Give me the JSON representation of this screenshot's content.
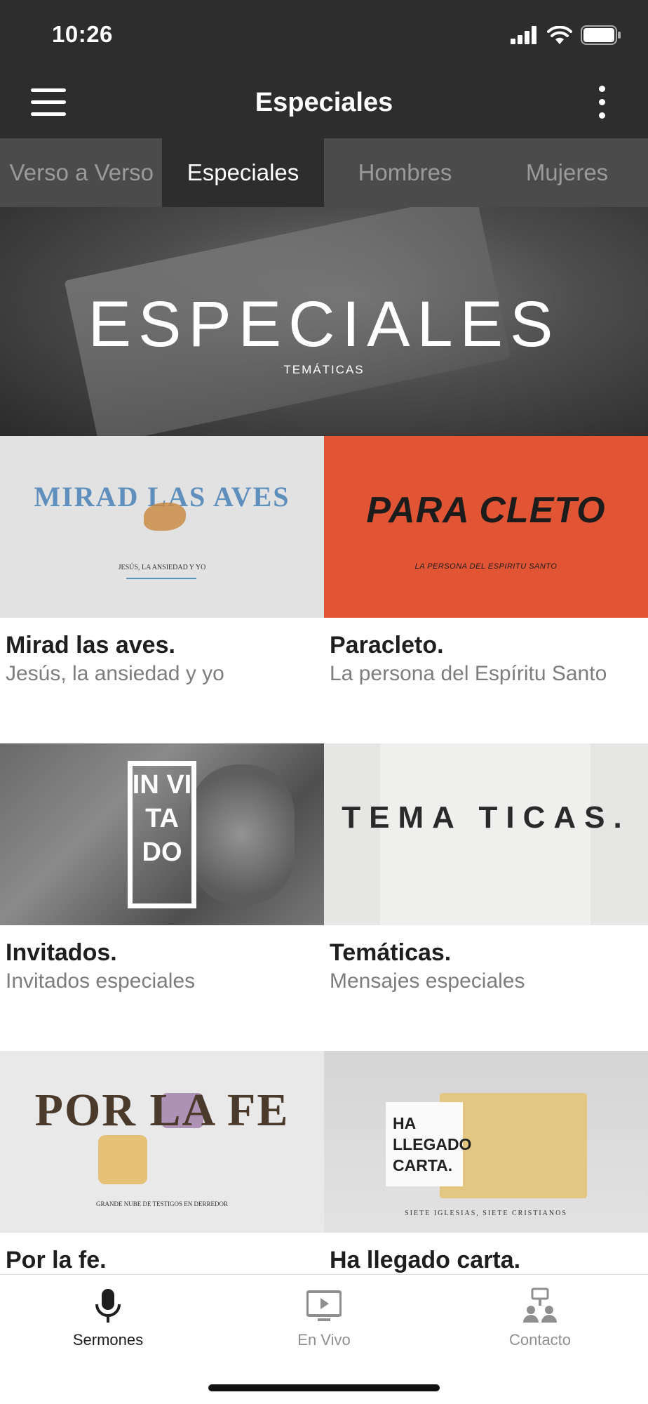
{
  "status_bar": {
    "time": "10:26"
  },
  "header": {
    "title": "Especiales"
  },
  "tabs": [
    {
      "label": "Verso a Verso",
      "active": false
    },
    {
      "label": "Especiales",
      "active": true
    },
    {
      "label": "Hombres",
      "active": false
    },
    {
      "label": "Mujeres",
      "active": false
    }
  ],
  "hero": {
    "title": "ESPECIALES",
    "subtitle": "TEMÁTICAS"
  },
  "series": [
    {
      "title": "Mirad las aves.",
      "subtitle": "Jesús, la ansiedad y yo",
      "art_title": "MIRAD LAS AVES",
      "art_sub": "JESÚS, LA ANSIEDAD Y YO"
    },
    {
      "title": "Paracleto.",
      "subtitle": "La persona del Espíritu Santo",
      "art_title": "PARA CLETO",
      "art_sub": "LA PERSONA DEL ESPIRITU SANTO"
    },
    {
      "title": "Invitados.",
      "subtitle": "Invitados especiales",
      "art_title": "IN VI TA DO"
    },
    {
      "title": "Temáticas.",
      "subtitle": "Mensajes especiales",
      "art_title": "TEMA TICAS."
    },
    {
      "title": "Por la fe.",
      "subtitle": "",
      "art_title": "POR LA FE",
      "art_sub": "GRANDE NUBE DE TESTIGOS EN DERREDOR"
    },
    {
      "title": "Ha llegado carta.",
      "subtitle": "",
      "art_title": "HA\nLLEGADO\nCARTA.",
      "art_sub": "SIETE IGLESIAS, SIETE CRISTIANOS"
    }
  ],
  "bottom_nav": [
    {
      "label": "Sermones",
      "icon": "microphone-icon",
      "active": true
    },
    {
      "label": "En Vivo",
      "icon": "live-video-icon",
      "active": false
    },
    {
      "label": "Contacto",
      "icon": "contact-network-icon",
      "active": false
    }
  ],
  "colors": {
    "header_bg": "#2d2d2d",
    "tab_bg": "#4b4b4b",
    "paracleto": "#e25534",
    "mirad_blue": "#5f90bd"
  }
}
